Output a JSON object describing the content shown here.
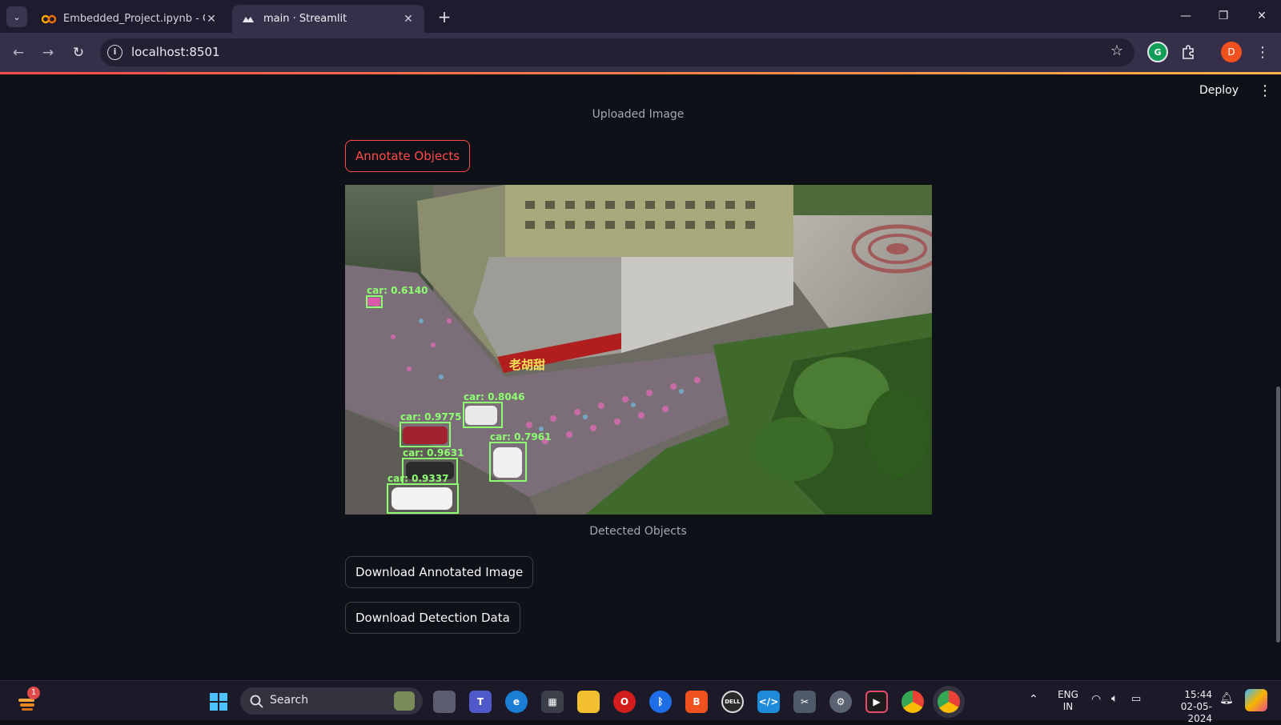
{
  "browser": {
    "tabs": [
      {
        "title": "Embedded_Project.ipynb - Cola",
        "active": false,
        "icon": "colab-icon"
      },
      {
        "title": "main · Streamlit",
        "active": true,
        "icon": "streamlit-icon"
      }
    ],
    "url": "localhost:8501",
    "profile_initial": "D"
  },
  "app": {
    "deploy_label": "Deploy",
    "uploaded_caption": "Uploaded Image",
    "annotate_button": "Annotate Objects",
    "detected_caption": "Detected Objects",
    "download_image_button": "Download Annotated Image",
    "download_data_button": "Download Detection Data",
    "detections": [
      {
        "label": "car: 0.6140"
      },
      {
        "label": "car: 0.8046"
      },
      {
        "label": "car: 0.9775"
      },
      {
        "label": "car: 0.7961"
      },
      {
        "label": "car: 0.9631"
      },
      {
        "label": "car: 0.9337"
      }
    ],
    "image_shop_sign": "老胡甜"
  },
  "taskbar": {
    "search_placeholder": "Search",
    "weather_badge": "1",
    "language": "ENG",
    "region": "IN",
    "time": "15:44",
    "date": "02-05-2024"
  },
  "colors": {
    "accent": "#ff4b4b",
    "background": "#0e1117",
    "detection_box": "#8dff70"
  }
}
